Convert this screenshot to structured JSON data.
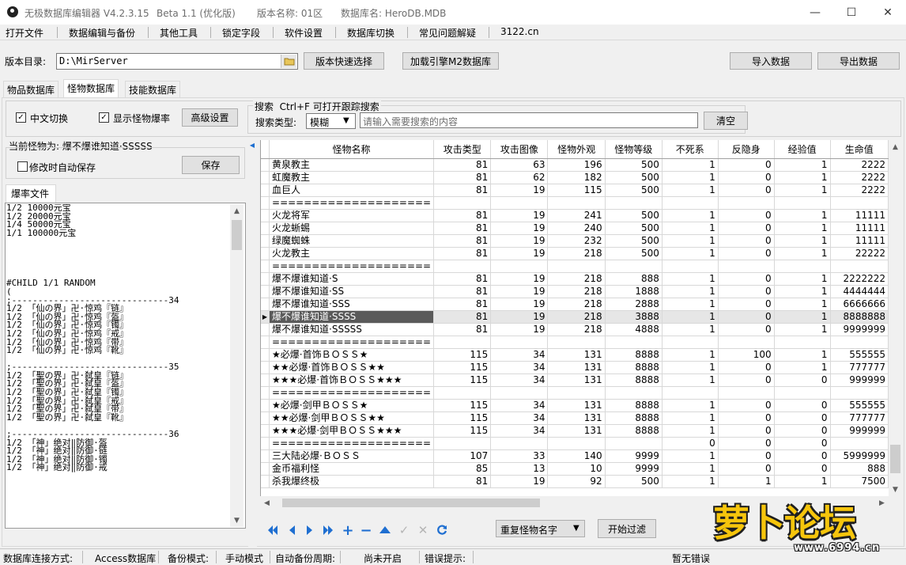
{
  "window": {
    "title": "无极数据库编辑器 V4.2.3.15",
    "beta": "Beta 1.1  (优化版)",
    "version_name": "版本名称: 01区",
    "database_name": "数据库名: HeroDB.MDB",
    "minimize": "—",
    "maximize": "☐",
    "close": "✕"
  },
  "menu": [
    "打开文件",
    "数据编辑与备份",
    "其他工具",
    "锁定字段",
    "软件设置",
    "数据库切换",
    "常见问题解疑",
    "3122.cn"
  ],
  "toolbar": {
    "dir_label": "版本目录:",
    "dir_value": "D:\\MirServer",
    "quick_select": "版本快速选择",
    "load_engine": "加载引擎M2数据库",
    "import": "导入数据",
    "export": "导出数据"
  },
  "tabs": [
    "物品数据库",
    "怪物数据库",
    "技能数据库"
  ],
  "options": {
    "chinese_switch": "中文切换",
    "show_drop_rate": "显示怪物爆率",
    "advanced": "高级设置"
  },
  "search": {
    "title": "搜索  Ctrl+F 可打开跟踪搜索",
    "type_label": "搜索类型:",
    "type_value": "模糊",
    "placeholder": "请输入需要搜索的内容",
    "clear": "清空"
  },
  "left_panel": {
    "current_monster": "当前怪物为: 爆不爆谁知道·SSSSS",
    "auto_save": "修改时自动保存",
    "save": "保存",
    "drop_tab": "爆率文件"
  },
  "drop_lines": [
    "1/2 10000元宝",
    "1/2 20000元宝",
    "1/4 50000元宝",
    "1/1 100000元宝",
    "",
    "",
    "",
    "",
    "",
    "#CHILD 1/1 RANDOM",
    "(",
    ";------------------------------34",
    "1/2 「仙の界」卍·惊鸡『链』",
    "1/2 「仙の界」卍·惊鸡『盔』",
    "1/2 「仙の界」卍·惊鸡『镯』",
    "1/2 「仙の界」卍·惊鸡『戒』",
    "1/2 「仙の界」卍·惊鸡『带』",
    "1/2 「仙の界」卍·惊鸡『靴』",
    "",
    ";------------------------------35",
    "1/2 「聖の界」卍·弑皇『链』",
    "1/2 「聖の界」卍·弑皇『盔』",
    "1/2 「聖の界」卍·弑皇『镯』",
    "1/2 「聖の界」卍·弑皇『戒』",
    "1/2 「聖の界」卍·弑皇『带』",
    "1/2 「聖の界」卍·弑皇『靴』",
    "",
    ";------------------------------36",
    "1/2 「神」绝对‖防御·盔",
    "1/2 「神」绝对‖防御·链",
    "1/2 「神」绝对‖防御·镯",
    "1/2 「神」绝对‖防御·戒"
  ],
  "grid": {
    "columns": [
      "怪物名称",
      "攻击类型",
      "攻击图像",
      "怪物外观",
      "怪物等级",
      "不死系",
      "反隐身",
      "经验值",
      "生命值"
    ],
    "rows": [
      [
        "黄泉教主",
        "81",
        "63",
        "196",
        "500",
        "1",
        "0",
        "1",
        "2222"
      ],
      [
        "虹魔教主",
        "81",
        "62",
        "182",
        "500",
        "1",
        "0",
        "1",
        "2222"
      ],
      [
        "血巨人",
        "81",
        "19",
        "115",
        "500",
        "1",
        "0",
        "1",
        "2222"
      ],
      [
        "====================",
        "",
        "",
        "",
        "",
        "",
        "",
        "",
        ""
      ],
      [
        "火龙将军",
        "81",
        "19",
        "241",
        "500",
        "1",
        "0",
        "1",
        "11111"
      ],
      [
        "火龙蜥蜴",
        "81",
        "19",
        "240",
        "500",
        "1",
        "0",
        "1",
        "11111"
      ],
      [
        "绿魔蜘蛛",
        "81",
        "19",
        "232",
        "500",
        "1",
        "0",
        "1",
        "11111"
      ],
      [
        "火龙教主",
        "81",
        "19",
        "218",
        "500",
        "1",
        "0",
        "1",
        "22222"
      ],
      [
        "====================",
        "",
        "",
        "",
        "",
        "",
        "",
        "",
        ""
      ],
      [
        "爆不爆谁知道·S",
        "81",
        "19",
        "218",
        "888",
        "1",
        "0",
        "1",
        "2222222"
      ],
      [
        "爆不爆谁知道·SS",
        "81",
        "19",
        "218",
        "1888",
        "1",
        "0",
        "1",
        "4444444"
      ],
      [
        "爆不爆谁知道·SSS",
        "81",
        "19",
        "218",
        "2888",
        "1",
        "0",
        "1",
        "6666666"
      ],
      [
        "爆不爆谁知道·SSSS",
        "81",
        "19",
        "218",
        "3888",
        "1",
        "0",
        "1",
        "8888888"
      ],
      [
        "爆不爆谁知道·SSSSS",
        "81",
        "19",
        "218",
        "4888",
        "1",
        "0",
        "1",
        "9999999"
      ],
      [
        "====================",
        "",
        "",
        "",
        "",
        "",
        "",
        "",
        ""
      ],
      [
        "★必爆·首饰ＢＯＳＳ★",
        "115",
        "34",
        "131",
        "8888",
        "1",
        "100",
        "1",
        "555555"
      ],
      [
        "★★必爆·首饰ＢＯＳＳ★★",
        "115",
        "34",
        "131",
        "8888",
        "1",
        "0",
        "1",
        "777777"
      ],
      [
        "★★★必爆·首饰ＢＯＳＳ★★★",
        "115",
        "34",
        "131",
        "8888",
        "1",
        "0",
        "0",
        "999999"
      ],
      [
        "====================",
        "",
        "",
        "",
        "",
        "",
        "",
        "",
        ""
      ],
      [
        "★必爆·剑甲ＢＯＳＳ★",
        "115",
        "34",
        "131",
        "8888",
        "1",
        "0",
        "0",
        "555555"
      ],
      [
        "★★必爆·剑甲ＢＯＳＳ★★",
        "115",
        "34",
        "131",
        "8888",
        "1",
        "0",
        "0",
        "777777"
      ],
      [
        "★★★必爆·剑甲ＢＯＳＳ★★★",
        "115",
        "34",
        "131",
        "8888",
        "1",
        "0",
        "0",
        "999999"
      ],
      [
        "====================",
        "",
        "",
        "",
        "",
        "0",
        "0",
        "0",
        ""
      ],
      [
        "三大陆必爆·ＢＯＳＳ",
        "107",
        "33",
        "140",
        "9999",
        "1",
        "0",
        "0",
        "5999999"
      ],
      [
        "金币福利怪",
        "85",
        "13",
        "10",
        "9999",
        "1",
        "0",
        "0",
        "888"
      ],
      [
        "杀我爆终极",
        "81",
        "19",
        "92",
        "500",
        "1",
        "1",
        "1",
        "7500"
      ]
    ],
    "selected_row": 12
  },
  "bottom": {
    "filter_mode": "重复怪物名字",
    "start_filter": "开始过滤"
  },
  "status": {
    "conn_label": "数据库连接方式:",
    "conn_value": "Access数据库",
    "backup_label": "备份模式:",
    "backup_value": "手动模式",
    "auto_label": "自动备份周期:",
    "auto_value": "尚未开启",
    "err_label": "错误提示:",
    "err_value": "暂无错误"
  },
  "watermark": {
    "main": "萝卜论坛",
    "sub": "www.6994.cn"
  }
}
